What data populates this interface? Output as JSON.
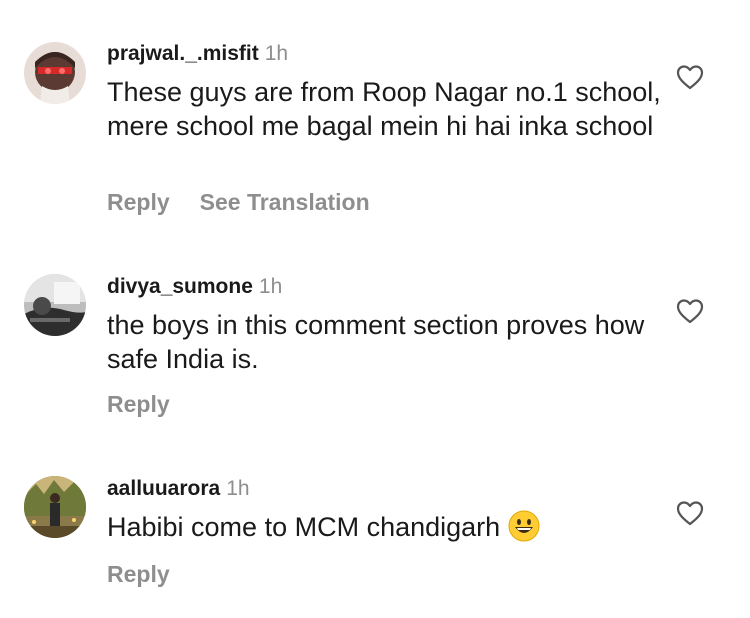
{
  "comments": [
    {
      "username": "prajwal._.misfit",
      "time": "1h",
      "text": "These guys are from Roop Nagar no.1 school, mere school me bagal mein hi hai inka school",
      "reply_label": "Reply",
      "translate_label": "See Translation",
      "like_icon": "heart-outline-icon"
    },
    {
      "username": "divya_sumone",
      "time": "1h",
      "text": "the boys in this comment section proves how safe India is.",
      "reply_label": "Reply",
      "like_icon": "heart-outline-icon"
    },
    {
      "username": "aalluuarora",
      "time": "1h",
      "text": "Habibi come to MCM chandigarh",
      "emoji": "grinning-face-emoji",
      "reply_label": "Reply",
      "like_icon": "heart-outline-icon"
    }
  ],
  "colors": {
    "text": "#1a1a1a",
    "muted": "#8e8e8e",
    "background": "#ffffff"
  }
}
